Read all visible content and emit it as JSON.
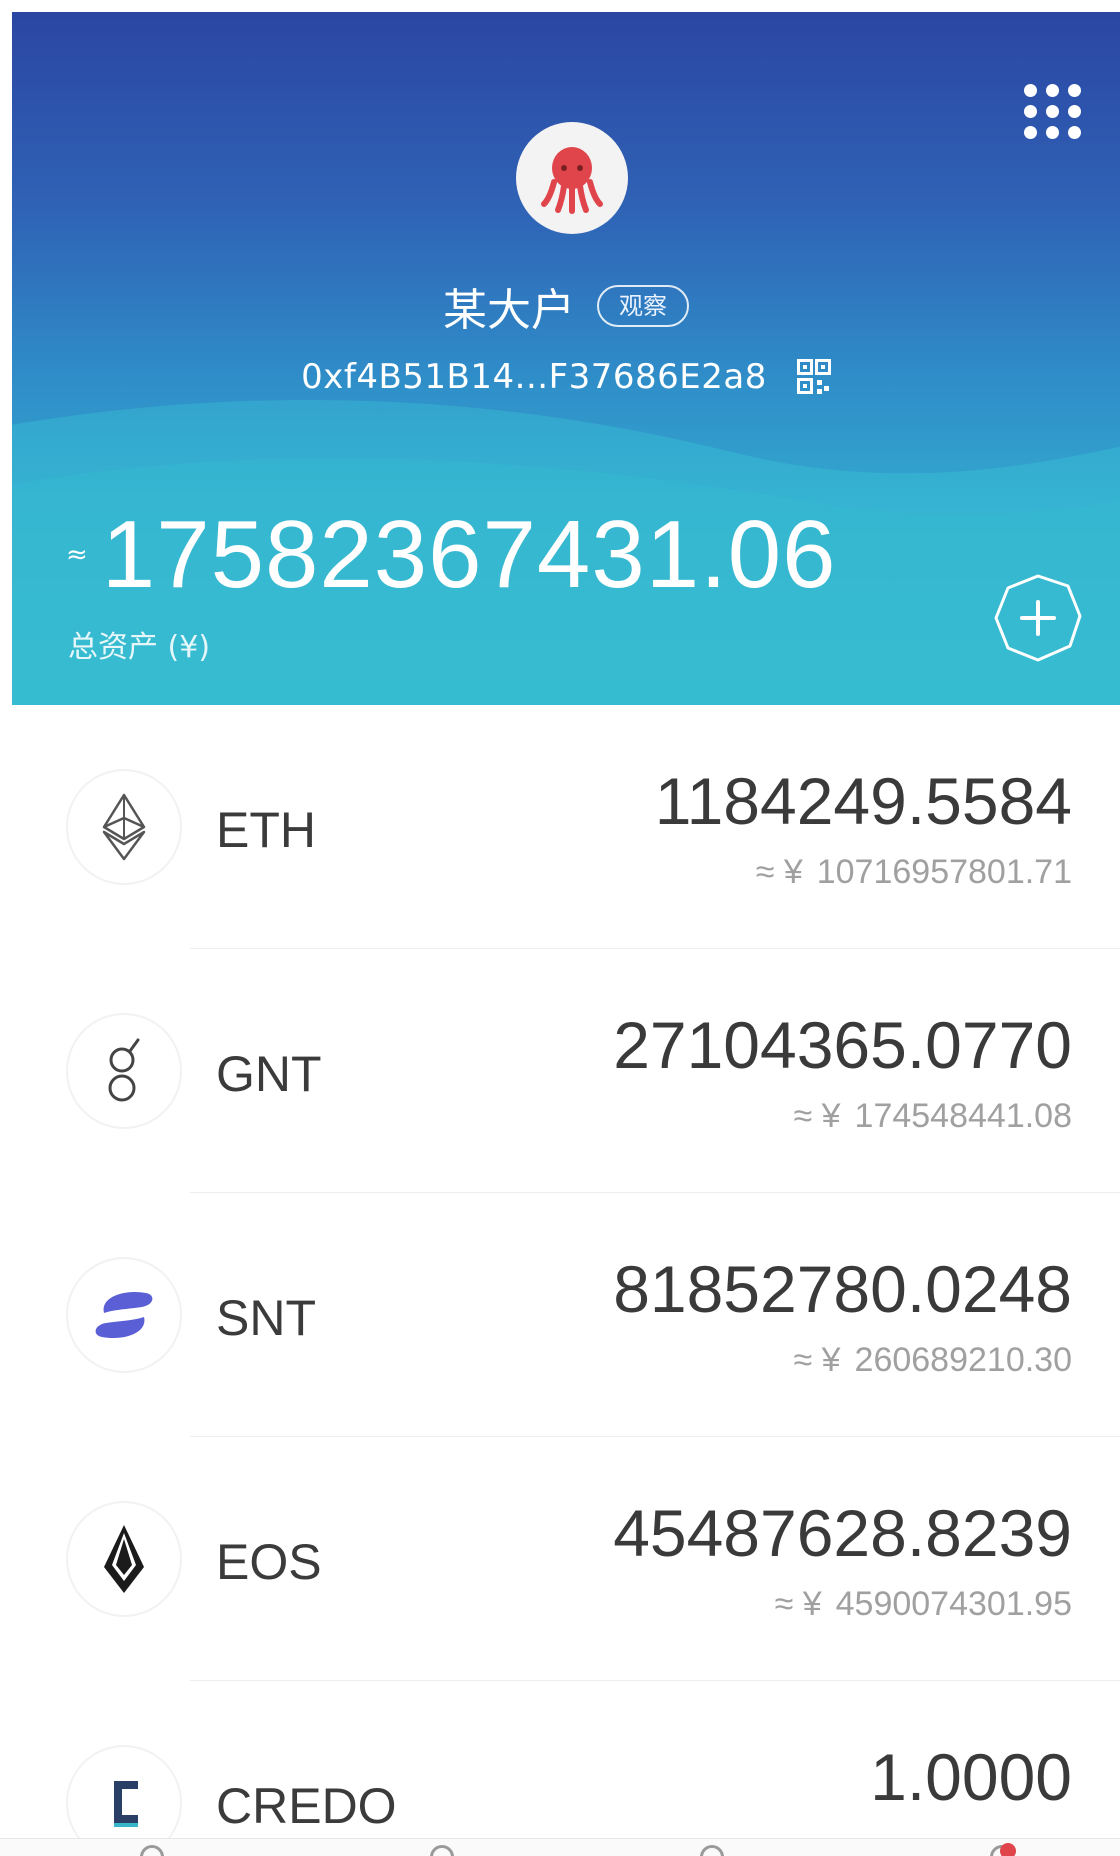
{
  "header": {
    "menu_icon": "grid-menu-icon",
    "avatar_icon": "octopus-avatar-icon",
    "wallet_name": "某大户",
    "watch_badge": "观察",
    "address": "0xf4B51B14...F37686E2a8",
    "qr_icon": "qr-code-icon",
    "approx_symbol": "≈",
    "total_balance": "17582367431.06",
    "total_label": "总资产 (¥)",
    "add_icon": "add-asset-icon"
  },
  "assets": [
    {
      "symbol": "ETH",
      "amount": "1184249.5584",
      "value_prefix": "≈ ¥",
      "value": "10716957801.71",
      "icon": "ethereum-icon"
    },
    {
      "symbol": "GNT",
      "amount": "27104365.0770",
      "value_prefix": "≈ ¥",
      "value": "174548441.08",
      "icon": "golem-icon"
    },
    {
      "symbol": "SNT",
      "amount": "81852780.0248",
      "value_prefix": "≈ ¥",
      "value": "260689210.30",
      "icon": "status-icon"
    },
    {
      "symbol": "EOS",
      "amount": "45487628.8239",
      "value_prefix": "≈ ¥",
      "value": "4590074301.95",
      "icon": "eos-icon"
    },
    {
      "symbol": "CREDO",
      "amount": "1.0000",
      "icon": "credo-icon"
    }
  ],
  "colors": {
    "header_top": "#2b46a3",
    "header_bottom": "#34b6d0",
    "snt_purple": "#5b5fd6",
    "avatar_red": "#e0454b"
  }
}
